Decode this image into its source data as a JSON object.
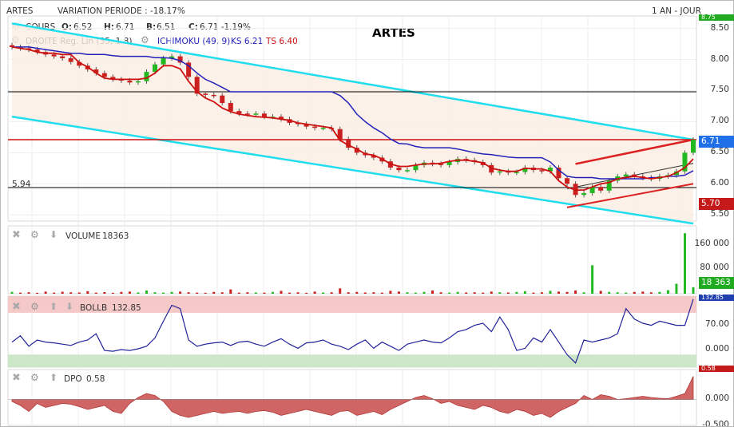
{
  "header": {
    "symbol": "ARTES",
    "variation": "VARIATION PERIODE : -18.17%",
    "period": "1 AN - JOUR",
    "title": "ARTES",
    "cours_label": "COURS",
    "open_label": "O:",
    "open": "6.52",
    "high_label": "H:",
    "high": "6.71",
    "low_label": "B:",
    "low": "6.51",
    "close_label": "C:",
    "close": "6.71 -1.19%",
    "droite": "DROITE Reg. Lin (35, 1.8)",
    "ichimoku": "ICHIMOKU (49, 9)",
    "ks": "KS 6.21",
    "ts": "TS 6.40"
  },
  "colors": {
    "up": "#22b822",
    "down": "#cc1f1f",
    "ichimoku_ks": "#2222bb",
    "ichimoku_ts": "#cc1111",
    "channel": "#22ddee",
    "bollb_line": "#22239a",
    "bollb_high": "#f6c9c9",
    "bollb_low": "#cbe7c8",
    "dpo_fill": "#cc5555"
  },
  "chart_data": [
    {
      "type": "candlestick",
      "panel": "price",
      "ylim": [
        5.4,
        8.7
      ],
      "ticks": [
        "8.50",
        "8.00",
        "7.50",
        "7.00",
        "6.50",
        "6.00",
        "5.50"
      ],
      "hlines": [
        {
          "value": 7.48,
          "color": "#000000"
        },
        {
          "value": 6.71,
          "color": "#cc1111"
        },
        {
          "value": 5.94,
          "color": "#000000",
          "label": "5.94"
        }
      ],
      "badges": [
        {
          "value": 6.71,
          "label": "6.71",
          "color": "#1f6fe8"
        },
        {
          "value": 5.7,
          "label": "5.70",
          "color": "#c41a1a"
        },
        {
          "value": 8.75,
          "label": "8.75",
          "color": "#22aa22"
        }
      ],
      "x_count": 82,
      "close": [
        8.2,
        8.18,
        8.16,
        8.12,
        8.08,
        8.05,
        8.02,
        7.96,
        7.9,
        7.84,
        7.78,
        7.72,
        7.68,
        7.66,
        7.63,
        7.65,
        7.8,
        7.92,
        8.02,
        8.05,
        7.95,
        7.72,
        7.45,
        7.43,
        7.42,
        7.3,
        7.17,
        7.13,
        7.12,
        7.13,
        7.08,
        7.08,
        7.04,
        6.98,
        6.96,
        6.92,
        6.9,
        6.9,
        6.88,
        6.72,
        6.58,
        6.5,
        6.46,
        6.42,
        6.36,
        6.26,
        6.22,
        6.22,
        6.3,
        6.34,
        6.32,
        6.3,
        6.35,
        6.4,
        6.38,
        6.35,
        6.3,
        6.18,
        6.2,
        6.18,
        6.19,
        6.26,
        6.22,
        6.2,
        6.26,
        6.09,
        6.0,
        5.82,
        5.85,
        5.95,
        5.89,
        6.05,
        6.12,
        6.15,
        6.12,
        6.1,
        6.08,
        6.12,
        6.14,
        6.2,
        6.5,
        6.71
      ],
      "ks": [
        8.2,
        8.2,
        8.2,
        8.18,
        8.16,
        8.14,
        8.12,
        8.1,
        8.1,
        8.08,
        8.08,
        8.08,
        8.06,
        8.05,
        8.05,
        8.05,
        8.05,
        8.03,
        8.03,
        8.02,
        7.98,
        7.9,
        7.78,
        7.68,
        7.62,
        7.55,
        7.48,
        7.48,
        7.48,
        7.48,
        7.48,
        7.48,
        7.48,
        7.48,
        7.48,
        7.48,
        7.48,
        7.48,
        7.48,
        7.42,
        7.3,
        7.12,
        7.0,
        6.9,
        6.82,
        6.72,
        6.65,
        6.64,
        6.6,
        6.58,
        6.58,
        6.58,
        6.58,
        6.56,
        6.53,
        6.5,
        6.48,
        6.47,
        6.45,
        6.43,
        6.42,
        6.42,
        6.42,
        6.42,
        6.35,
        6.22,
        6.12,
        6.1,
        6.1,
        6.1,
        6.08,
        6.08,
        6.08,
        6.08,
        6.08,
        6.08,
        6.1,
        6.1,
        6.12,
        6.12,
        6.14,
        6.21
      ],
      "ts": [
        8.2,
        8.18,
        8.16,
        8.12,
        8.1,
        8.1,
        8.08,
        8.08,
        7.95,
        7.88,
        7.78,
        7.7,
        7.68,
        7.68,
        7.68,
        7.68,
        7.7,
        7.78,
        7.9,
        7.9,
        7.85,
        7.65,
        7.48,
        7.38,
        7.32,
        7.22,
        7.16,
        7.12,
        7.1,
        7.08,
        7.07,
        7.06,
        7.04,
        7.02,
        6.98,
        6.96,
        6.94,
        6.92,
        6.9,
        6.7,
        6.62,
        6.56,
        6.48,
        6.46,
        6.4,
        6.32,
        6.28,
        6.28,
        6.3,
        6.32,
        6.32,
        6.33,
        6.36,
        6.38,
        6.38,
        6.36,
        6.34,
        6.25,
        6.22,
        6.2,
        6.2,
        6.25,
        6.24,
        6.24,
        6.2,
        6.05,
        5.95,
        5.9,
        5.9,
        5.95,
        6.0,
        6.02,
        6.08,
        6.1,
        6.12,
        6.1,
        6.08,
        6.1,
        6.12,
        6.18,
        6.26,
        6.4
      ]
    },
    {
      "type": "bar",
      "panel": "volume",
      "name": "VOLUME",
      "last": "18363",
      "last_label": "18 363",
      "ticks": [
        "160 000",
        "80 000"
      ],
      "ylim": [
        0,
        175000
      ],
      "spikes": [
        {
          "index": 69,
          "value": 80000
        },
        {
          "index": 79,
          "value": 28000
        },
        {
          "index": 80,
          "value": 170000
        }
      ],
      "base": [
        5000,
        3000,
        4000,
        2500,
        6000,
        3000,
        5500,
        4000,
        3500,
        7000,
        3000,
        4500,
        2500,
        5000,
        6000,
        3500,
        9000,
        4000,
        3000,
        5000,
        6000,
        4000,
        3000,
        2500,
        5000,
        4000,
        12000,
        3000,
        4000,
        3500,
        3000,
        5000,
        8000,
        3000,
        4000,
        2500,
        6000,
        3500,
        4000,
        15000,
        4000,
        5000,
        3500,
        4000,
        3000,
        8000,
        6000,
        4000,
        3000,
        5000,
        9000,
        4000,
        3000,
        5000,
        3500,
        4000,
        3000,
        6000,
        4000,
        3500,
        5000,
        7000,
        3000,
        4000,
        8000,
        6000,
        5000,
        9000,
        4000,
        6000,
        8000,
        5000,
        4000,
        3000,
        5000,
        6000,
        4000,
        5000,
        10000,
        4000,
        8000,
        18363
      ]
    },
    {
      "type": "line",
      "panel": "bollb",
      "name": "BOLLB",
      "last": "132.85",
      "ticks": [
        "70.00",
        "0.000"
      ],
      "ylim": [
        -30,
        140
      ],
      "values": [
        30,
        45,
        20,
        35,
        30,
        28,
        25,
        22,
        30,
        35,
        50,
        10,
        8,
        12,
        10,
        14,
        20,
        40,
        80,
        118,
        110,
        35,
        20,
        25,
        28,
        30,
        22,
        30,
        32,
        25,
        20,
        30,
        38,
        25,
        15,
        28,
        30,
        35,
        25,
        20,
        12,
        25,
        35,
        15,
        30,
        20,
        10,
        25,
        30,
        35,
        30,
        28,
        40,
        55,
        60,
        70,
        75,
        55,
        90,
        60,
        10,
        15,
        40,
        30,
        60,
        30,
        0,
        -20,
        35,
        30,
        35,
        40,
        50,
        110,
        85,
        75,
        70,
        80,
        75,
        70,
        70,
        133
      ]
    },
    {
      "type": "area",
      "panel": "dpo",
      "name": "DPO",
      "last": "0.58",
      "ticks": [
        "0.500",
        "0.000",
        "-0.500"
      ],
      "ylim": [
        -0.65,
        0.75
      ],
      "values": [
        -0.05,
        -0.15,
        -0.3,
        -0.1,
        -0.2,
        -0.15,
        -0.1,
        -0.12,
        -0.18,
        -0.25,
        -0.2,
        -0.15,
        -0.3,
        -0.35,
        -0.1,
        0.05,
        0.15,
        0.1,
        -0.05,
        -0.3,
        -0.4,
        -0.45,
        -0.4,
        -0.35,
        -0.3,
        -0.35,
        -0.32,
        -0.3,
        -0.35,
        -0.3,
        -0.28,
        -0.32,
        -0.4,
        -0.35,
        -0.3,
        -0.25,
        -0.3,
        -0.35,
        -0.4,
        -0.3,
        -0.28,
        -0.4,
        -0.35,
        -0.3,
        -0.38,
        -0.25,
        -0.15,
        -0.05,
        0.05,
        0.1,
        0.02,
        -0.1,
        -0.05,
        -0.15,
        -0.2,
        -0.25,
        -0.15,
        -0.2,
        -0.3,
        -0.35,
        -0.25,
        -0.3,
        -0.4,
        -0.35,
        -0.45,
        -0.3,
        -0.2,
        -0.1,
        0.1,
        0.0,
        0.12,
        0.08,
        0.0,
        0.02,
        0.05,
        0.08,
        0.05,
        0.03,
        0.02,
        0.08,
        0.15,
        0.58
      ]
    }
  ]
}
